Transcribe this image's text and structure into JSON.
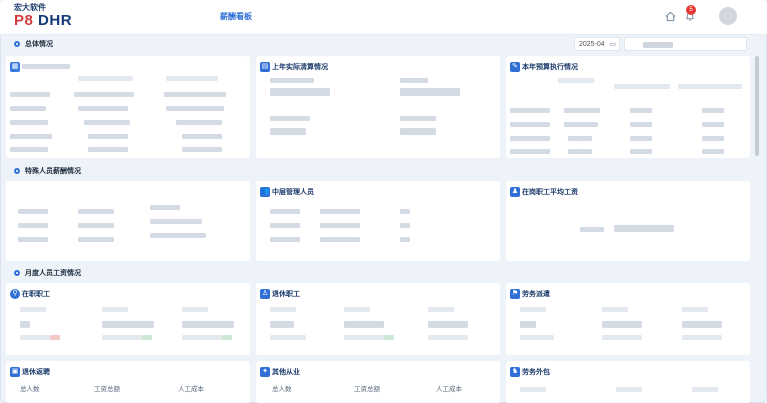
{
  "header": {
    "company": "宏大软件",
    "product_prefix": "P8",
    "product_suffix": " DHR",
    "nav_tab": "薪酬看板",
    "notification_count": "5"
  },
  "filters": {
    "month": "2025-04"
  },
  "sections": {
    "overview": "总体情况",
    "special": "特殊人员薪酬情况",
    "monthly": "月度人员工资情况"
  },
  "cards": {
    "last_year_settlement": "上年实际清算情况",
    "budget_execution": "本年预算执行情况",
    "middle_management": "中层管理人员",
    "avg_salary": "在岗职工平均工资",
    "active_staff": "在职职工",
    "retired_staff": "退休职工",
    "labor_dispatch": "劳务派遣",
    "retired_rehire": "退休返聘",
    "other_workers": "其他从业",
    "labor_outsourcing": "劳务外包"
  },
  "metrics": {
    "headcount": "总人数",
    "total_wages": "工资总额",
    "labor_cost": "人工成本"
  },
  "colors": {
    "accent": "#2f6fd6",
    "brand_red": "#d13b3b",
    "badge": "#e53935"
  }
}
